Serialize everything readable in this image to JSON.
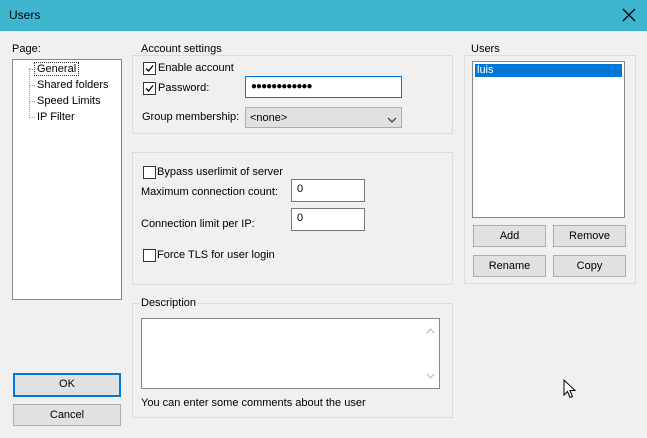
{
  "window": {
    "title": "Users"
  },
  "page_section": {
    "label": "Page:",
    "items": [
      "General",
      "Shared folders",
      "Speed Limits",
      "IP Filter"
    ],
    "selected": "General"
  },
  "account_settings": {
    "legend": "Account settings",
    "enable_account": {
      "label": "Enable account",
      "checked": true
    },
    "password": {
      "label": "Password:",
      "checked": true,
      "value": "●●●●●●●●●●●●"
    },
    "group_membership": {
      "label": "Group membership:",
      "value": "<none>"
    }
  },
  "limits": {
    "bypass_userlimit": {
      "label": "Bypass userlimit of server",
      "checked": false
    },
    "max_connection": {
      "label": "Maximum connection count:",
      "value": "0"
    },
    "conn_limit_per_ip": {
      "label": "Connection limit per IP:",
      "value": "0"
    },
    "force_tls": {
      "label": "Force TLS for user login",
      "checked": false
    }
  },
  "description": {
    "legend": "Description",
    "value": "",
    "hint": "You can enter some comments about the user"
  },
  "users": {
    "legend": "Users",
    "items": [
      "luis"
    ],
    "selected": "luis",
    "buttons": {
      "add": "Add",
      "remove": "Remove",
      "rename": "Rename",
      "copy": "Copy"
    }
  },
  "dialog_buttons": {
    "ok": "OK",
    "cancel": "Cancel"
  },
  "colors": {
    "titlebar": "#40b5d0",
    "selection": "#0078d7",
    "default_button_border": "#0078d7"
  }
}
